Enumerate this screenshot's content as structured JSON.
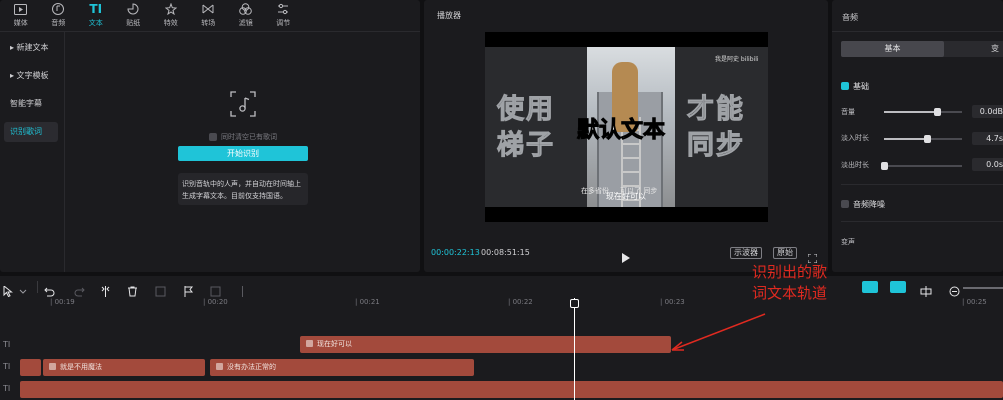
{
  "toolbar": {
    "items": [
      {
        "label": "媒体",
        "icon": "media-icon"
      },
      {
        "label": "音频",
        "icon": "audio-icon"
      },
      {
        "label": "文本",
        "icon": "text-icon"
      },
      {
        "label": "贴纸",
        "icon": "sticker-icon"
      },
      {
        "label": "特效",
        "icon": "effects-icon"
      },
      {
        "label": "转场",
        "icon": "transition-icon"
      },
      {
        "label": "滤镜",
        "icon": "filter-icon"
      },
      {
        "label": "调节",
        "icon": "adjust-icon"
      }
    ],
    "active_index": 2
  },
  "sidebar": {
    "items": [
      {
        "label": "▸ 新建文本"
      },
      {
        "label": "▸ 文字模板"
      },
      {
        "label": "智能字幕"
      },
      {
        "label": "识别歌词"
      }
    ],
    "active_index": 3
  },
  "lyrics_panel": {
    "clear_label": "同时清空已有歌词",
    "start_button": "开始识别",
    "hint_line1": "识别音轨中的人声，并自动在时间轴上",
    "hint_line2": "生成字幕文本。目前仅支持国语。"
  },
  "player": {
    "title": "播放器",
    "overlay_left_top": "使用",
    "overlay_left_bottom": "梯子",
    "overlay_right_top": "才能",
    "overlay_right_bottom": "同步",
    "default_text": "默认文本",
    "watermark": "我是阿史 bilibili",
    "subtitle_small": "在多省份 ... 可以了 同步",
    "subtitle_main": "现在好可以",
    "current_time": "00:00:22:13",
    "total_time": "00:08:51:15",
    "btn_scope": "示波器",
    "btn_original": "原始"
  },
  "audio_panel": {
    "title": "音频",
    "tab_basic": "基本",
    "tab_other": "变",
    "basic_section": "基础",
    "volume_label": "音量",
    "volume_value": "0.0dB",
    "volume_level": 0.68,
    "fade_in_label": "淡入时长",
    "fade_in_value": "4.7s",
    "fade_in_level": 0.55,
    "fade_out_label": "淡出时长",
    "fade_out_value": "0.0s",
    "fade_out_level": 0.0,
    "denoise_label": "音频降噪",
    "voice_change_label": "变声"
  },
  "timeline": {
    "ticks": [
      {
        "label": "| 00:19"
      },
      {
        "label": "| 00:20"
      },
      {
        "label": "| 00:21"
      },
      {
        "label": "| 00:22"
      },
      {
        "label": "| 00:23"
      },
      {
        "label": "| 00:25"
      }
    ],
    "track_labels": [
      "TI",
      "TI",
      "TI"
    ],
    "clips": {
      "lyric": "现在好可以",
      "clip_a": "就是不用魔法",
      "clip_b": "没有办法正常的"
    }
  },
  "annotation": {
    "line1": "识别出的歌",
    "line2": "词文本轨道"
  },
  "colors": {
    "accent": "#1fc4d8",
    "clip": "#a34a3c",
    "annotation": "#e02a20"
  }
}
